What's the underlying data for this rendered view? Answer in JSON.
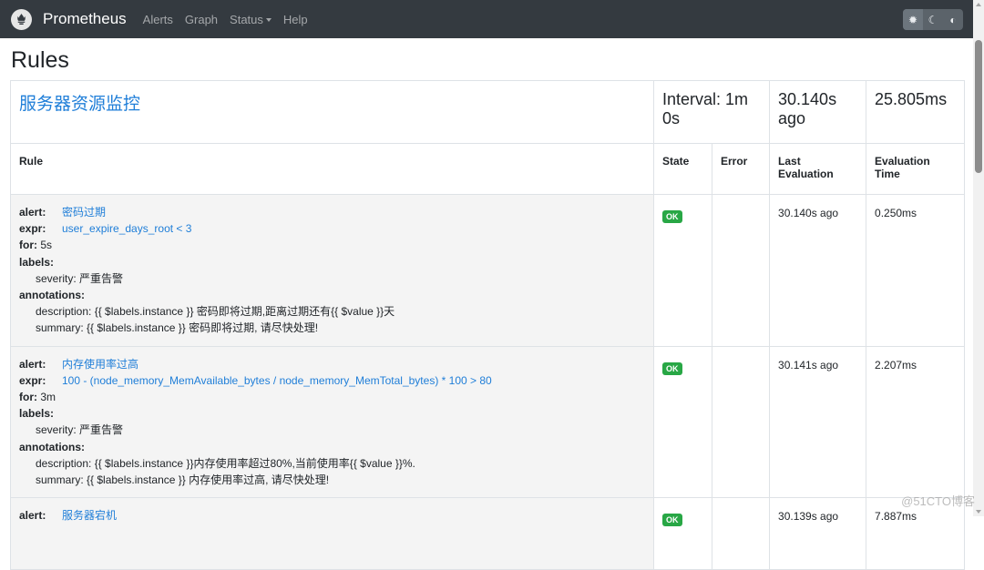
{
  "navbar": {
    "brand": "Prometheus",
    "links": [
      {
        "label": "Alerts"
      },
      {
        "label": "Graph"
      },
      {
        "label": "Status",
        "dropdown": true
      },
      {
        "label": "Help"
      }
    ],
    "theme_buttons": [
      {
        "icon": "gear-icon",
        "glyph": "✹",
        "active": true
      },
      {
        "icon": "moon-icon",
        "glyph": "☾",
        "active": false
      },
      {
        "icon": "half-circle-icon",
        "glyph": "◐",
        "active": false
      }
    ]
  },
  "page": {
    "title": "Rules"
  },
  "group": {
    "name": "服务器资源监控",
    "interval": "Interval: 1m 0s",
    "last_evaluation": "30.140s ago",
    "evaluation_time": "25.805ms"
  },
  "columns": {
    "rule": "Rule",
    "state": "State",
    "error": "Error",
    "last_evaluation": "Last Evaluation",
    "evaluation_time": "Evaluation Time"
  },
  "labels": {
    "alert": "alert:",
    "expr": "expr:",
    "for": "for:",
    "labels": "labels:",
    "annotations": "annotations:"
  },
  "rules": [
    {
      "alert": "密码过期",
      "expr": "user_expire_days_root < 3",
      "for": "5s",
      "severity": "severity: 严重告警",
      "description": "description: {{ $labels.instance }} 密码即将过期,距离过期还有{{ $value }}天",
      "summary": "summary: {{ $labels.instance }} 密码即将过期, 请尽快处理!",
      "state": "OK",
      "error": "",
      "last_evaluation": "30.140s ago",
      "evaluation_time": "0.250ms"
    },
    {
      "alert": "内存使用率过高",
      "expr": "100 - (node_memory_MemAvailable_bytes / node_memory_MemTotal_bytes) * 100 > 80",
      "for": "3m",
      "severity": "severity: 严重告警",
      "description": "description: {{ $labels.instance }}内存使用率超过80%,当前使用率{{ $value }}%.",
      "summary": "summary: {{ $labels.instance }} 内存使用率过高, 请尽快处理!",
      "state": "OK",
      "error": "",
      "last_evaluation": "30.141s ago",
      "evaluation_time": "2.207ms"
    },
    {
      "alert": "服务器宕机",
      "state": "OK",
      "error": "",
      "last_evaluation": "30.139s ago",
      "evaluation_time": "7.887ms"
    }
  ],
  "watermark": "@51CTO博客",
  "colors": {
    "navbar_bg": "#343a40",
    "link": "#1f7ed8",
    "ok_badge": "#28a745",
    "rule_cell_bg": "#f4f4f4"
  }
}
